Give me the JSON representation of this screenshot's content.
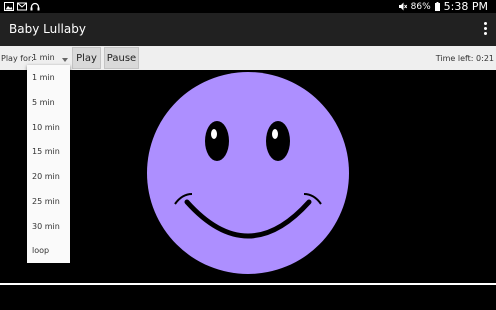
{
  "status_bar": {
    "battery": "86%",
    "time": "5:38 PM",
    "left_icons": [
      "image-icon",
      "mail-icon",
      "headphones-icon"
    ]
  },
  "app_bar": {
    "title": "Baby Lullaby"
  },
  "controls": {
    "play_for_label": "Play for:",
    "selected_duration": "1 min",
    "play_label": "Play",
    "pause_label": "Pause",
    "time_left": "Time left: 0:21"
  },
  "dropdown": {
    "options": [
      "1 min",
      "5 min",
      "10 min",
      "15 min",
      "20 min",
      "25 min",
      "30 min",
      "loop"
    ]
  },
  "colors": {
    "face": "#ad8fff",
    "background": "#000000",
    "toolbar": "#212121",
    "controls_bg": "#efefef"
  }
}
